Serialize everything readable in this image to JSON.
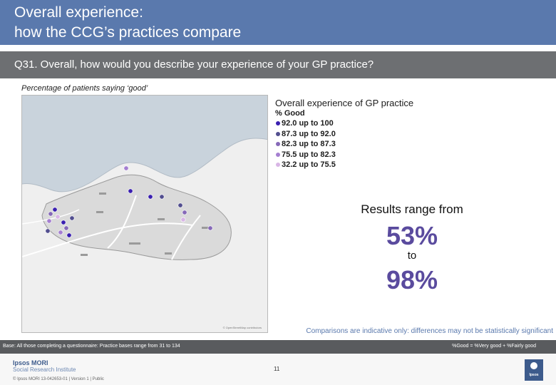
{
  "slide": {
    "title_line1": "Overall experience:",
    "title_line2": "how the CCG’s practices compare",
    "question": "Q31. Overall, how would you describe your experience of your GP practice?",
    "subtitle": "Percentage of patients saying ‘good’"
  },
  "legend": {
    "title": "Overall experience of GP practice",
    "subtitle": "% Good",
    "items": [
      {
        "label": "92.0 up to 100",
        "color": "#3a1fb0"
      },
      {
        "label": "87.3 up to 92.0",
        "color": "#524e8f"
      },
      {
        "label": "82.3 up to 87.3",
        "color": "#8669b8"
      },
      {
        "label": "75.5 up to 82.3",
        "color": "#a57fd1"
      },
      {
        "label": "32.2 up to 75.5",
        "color": "#d9b6e6"
      }
    ]
  },
  "results": {
    "intro": "Results range from",
    "min": "53%",
    "connector": "to",
    "max": "98%"
  },
  "comparison_note": "Comparisons are indicative only: differences may not be statistically significant",
  "base_note": "Base: All those completing a questionnaire: Practice bases range from 31 to 134",
  "good_definition": "%Good = %Very good + %Fairly good",
  "footer": {
    "brand_line1": "Ipsos MORI",
    "brand_line2": "Social Research Institute",
    "copyright": "© Ipsos MORI     13-042653-01 | Version 1 | Public",
    "page_number": "11",
    "logo_text": "Ipsos"
  },
  "map": {
    "credit": "© OpenStreetMap contributors"
  },
  "colors": {
    "title_band": "#5a79ad",
    "question_band": "#6d6f72",
    "accent_value": "#5a4b9e"
  }
}
